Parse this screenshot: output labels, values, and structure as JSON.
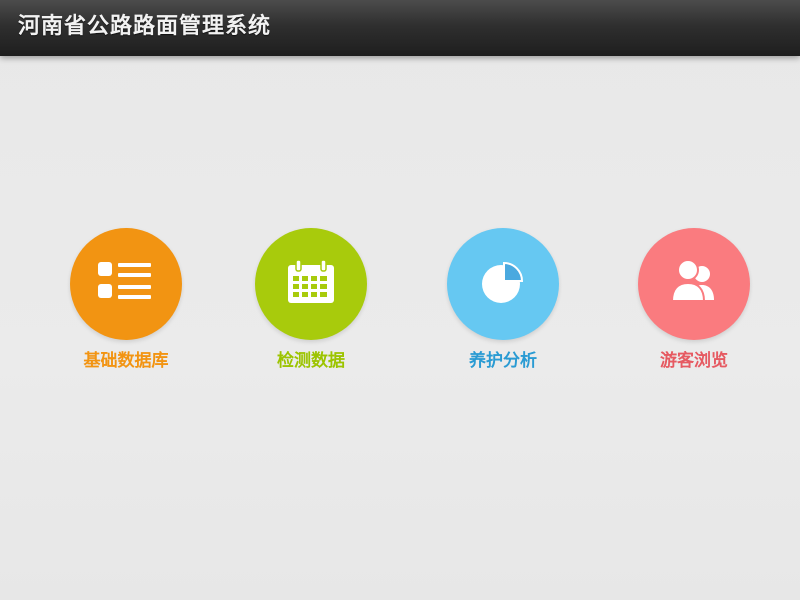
{
  "header": {
    "title": "河南省公路路面管理系统"
  },
  "modules": [
    {
      "label": "基础数据库",
      "icon": "list-icon",
      "color": "#f29412",
      "label_color": "#f29412"
    },
    {
      "label": "检测数据",
      "icon": "calendar-icon",
      "color": "#a8cb0c",
      "label_color": "#9cc400"
    },
    {
      "label": "养护分析",
      "icon": "pie-chart-icon",
      "color": "#66c8f2",
      "label_color": "#2a9bd3"
    },
    {
      "label": "游客浏览",
      "icon": "users-icon",
      "color": "#fa7b7f",
      "label_color": "#e65a62"
    }
  ]
}
